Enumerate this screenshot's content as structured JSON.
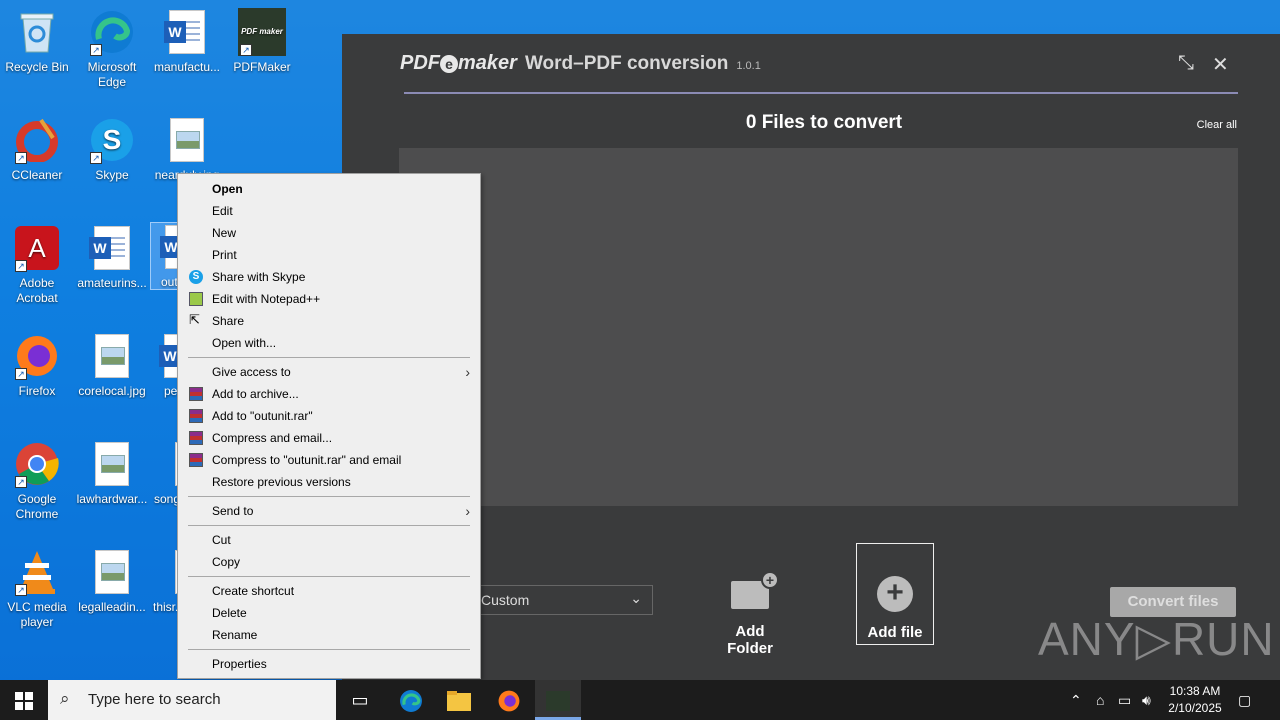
{
  "desktop": {
    "icons": [
      {
        "label": "Recycle Bin"
      },
      {
        "label": "Microsoft Edge"
      },
      {
        "label": "manufactu..."
      },
      {
        "label": "PDFMaker"
      },
      {
        "label": "CCleaner"
      },
      {
        "label": "Skype"
      },
      {
        "label": "nearduly.jpg"
      },
      {
        "label": "Adobe Acrobat"
      },
      {
        "label": "amateurins..."
      },
      {
        "label": "out..."
      },
      {
        "label": "Firefox"
      },
      {
        "label": "corelocal.jpg"
      },
      {
        "label": "pe..."
      },
      {
        "label": "Google Chrome"
      },
      {
        "label": "lawhardwar..."
      },
      {
        "label": "song..."
      },
      {
        "label": "VLC media player"
      },
      {
        "label": "legalleadin..."
      },
      {
        "label": "thisr..."
      }
    ]
  },
  "app": {
    "brand": "PDF",
    "brand_e": "e",
    "brand_suffix": "maker",
    "title": "Word–PDF conversion",
    "version": "1.0.1",
    "files_count": "0 Files to convert",
    "clear_all": "Clear all",
    "dropdown_value": "Custom",
    "add_folder": "Add Folder",
    "add_file": "Add file",
    "convert": "Convert files",
    "watermark": "ANY▷RUN"
  },
  "context_menu": {
    "items": [
      {
        "label": "Open"
      },
      {
        "label": "Edit"
      },
      {
        "label": "New"
      },
      {
        "label": "Print"
      },
      {
        "label": "Share with Skype"
      },
      {
        "label": "Edit with Notepad++"
      },
      {
        "label": "Share"
      },
      {
        "label": "Open with..."
      },
      {
        "label": "Give access to"
      },
      {
        "label": "Add to archive..."
      },
      {
        "label": "Add to \"outunit.rar\""
      },
      {
        "label": "Compress and email..."
      },
      {
        "label": "Compress to \"outunit.rar\" and email"
      },
      {
        "label": "Restore previous versions"
      },
      {
        "label": "Send to"
      },
      {
        "label": "Cut"
      },
      {
        "label": "Copy"
      },
      {
        "label": "Create shortcut"
      },
      {
        "label": "Delete"
      },
      {
        "label": "Rename"
      },
      {
        "label": "Properties"
      }
    ]
  },
  "taskbar": {
    "search_placeholder": "Type here to search",
    "time": "10:38 AM",
    "date": "2/10/2025"
  }
}
